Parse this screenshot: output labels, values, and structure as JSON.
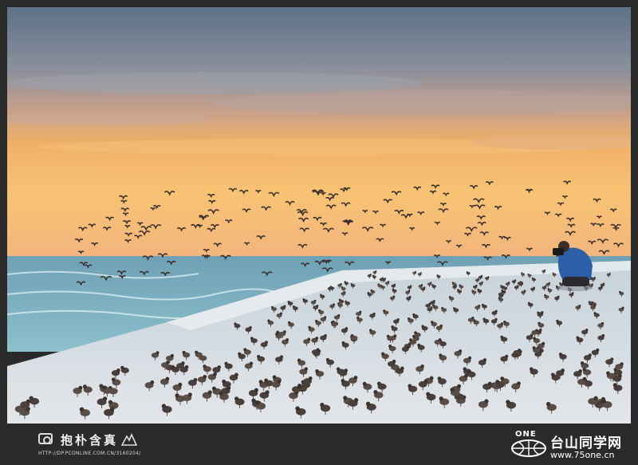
{
  "scene": {
    "description_colors": {
      "sky_top": "#5f7389",
      "sky_mid": "#c7a088",
      "sunset": "#f6b960",
      "sea": "#7fb3c2",
      "sand": "#d8e0e6",
      "bird": "#3a3230"
    },
    "subject_icons": [
      "flock-of-birds",
      "photographer",
      "sea-waves",
      "sandy-beach"
    ]
  },
  "watermark_left": {
    "name": "抱朴含真",
    "url": "HTTP://DP.PCONLINE.COM.CN/3160204/"
  },
  "watermark_right": {
    "logo_text": "ONE",
    "site_name": "台山同学网",
    "url": "www.75one.cn"
  }
}
